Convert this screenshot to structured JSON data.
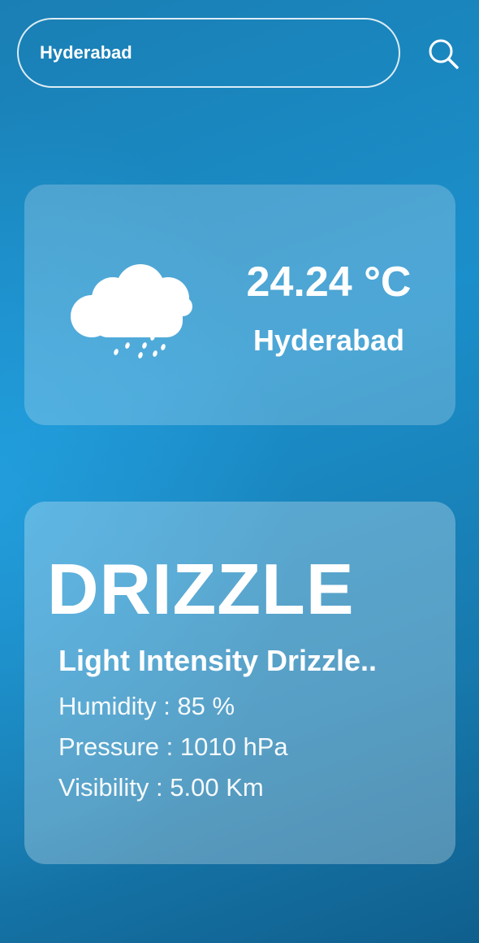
{
  "search": {
    "value": "Hyderabad",
    "icon": "search-icon"
  },
  "current": {
    "icon": "cloud-drizzle-icon",
    "temperature": "24.24 °C",
    "city": "Hyderabad"
  },
  "details": {
    "condition": "DRIZZLE",
    "description": "Light Intensity Drizzle..",
    "humidity": "Humidity : 85 %",
    "pressure": "Pressure : 1010 hPa",
    "visibility": "Visibility : 5.00 Km"
  },
  "colors": {
    "background_top": "#1a7fb4",
    "background_bottom": "#0f5f8d",
    "text": "#ffffff"
  }
}
